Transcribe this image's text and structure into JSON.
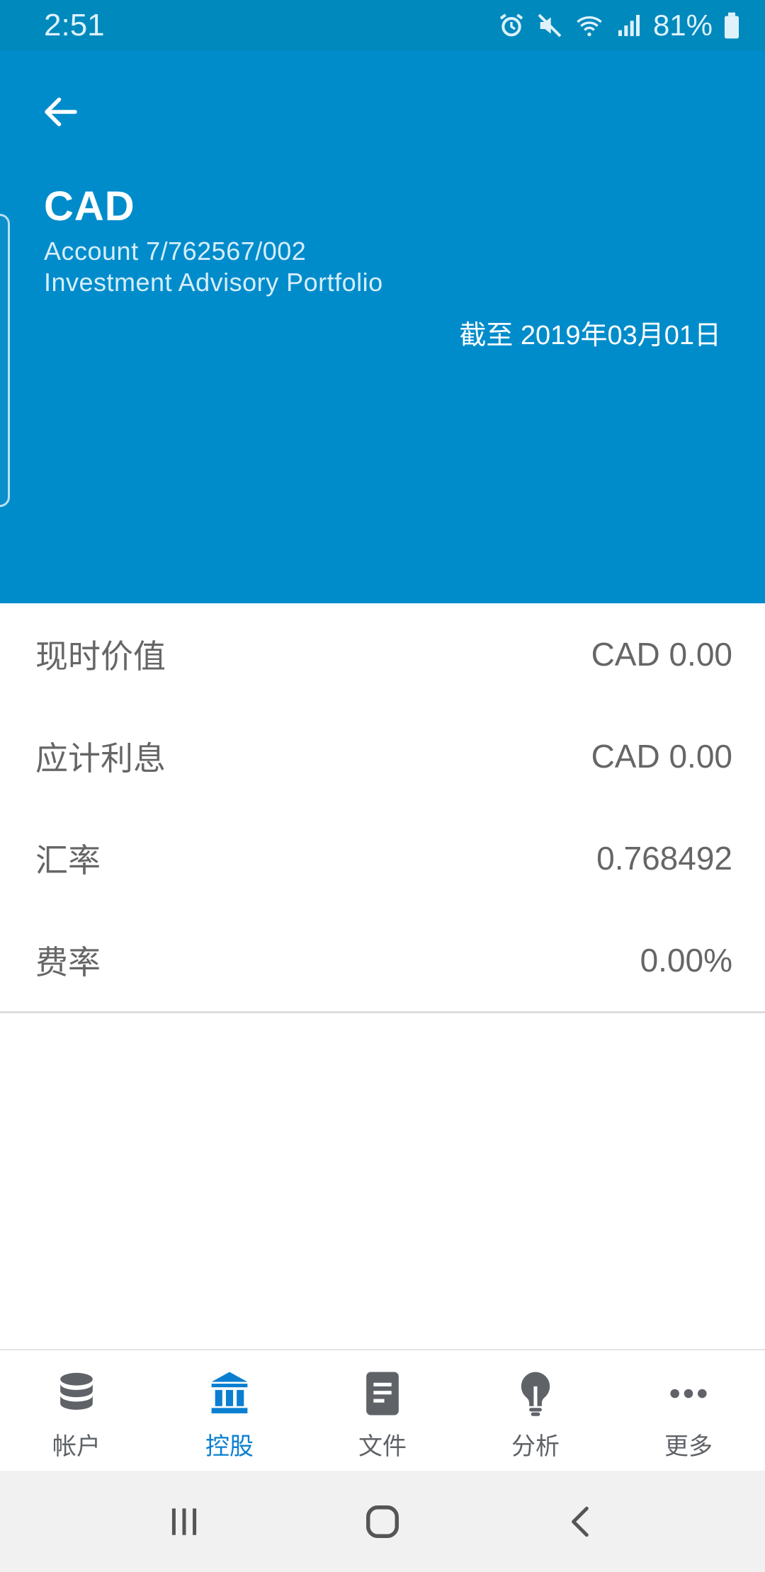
{
  "status_bar": {
    "time": "2:51",
    "battery": "81%"
  },
  "header": {
    "currency": "CAD",
    "account": "Account 7/762567/002",
    "portfolio": "Investment Advisory Portfolio",
    "as_of": "截至 2019年03月01日"
  },
  "details": [
    {
      "label": "现时价值",
      "value": "CAD 0.00"
    },
    {
      "label": "应计利息",
      "value": "CAD 0.00"
    },
    {
      "label": "汇率",
      "value": "0.768492"
    },
    {
      "label": "费率",
      "value": "0.00%"
    }
  ],
  "bottom_nav": [
    {
      "label": "帐户",
      "icon": "database-icon"
    },
    {
      "label": "控股",
      "icon": "bank-icon",
      "active": true
    },
    {
      "label": "文件",
      "icon": "document-icon"
    },
    {
      "label": "分析",
      "icon": "lightbulb-icon"
    },
    {
      "label": "更多",
      "icon": "more-icon"
    }
  ],
  "colors": {
    "header": "#008ccb",
    "status_bar": "#0089bd",
    "active_tab": "#0a7fd1",
    "text_muted": "#666666"
  }
}
